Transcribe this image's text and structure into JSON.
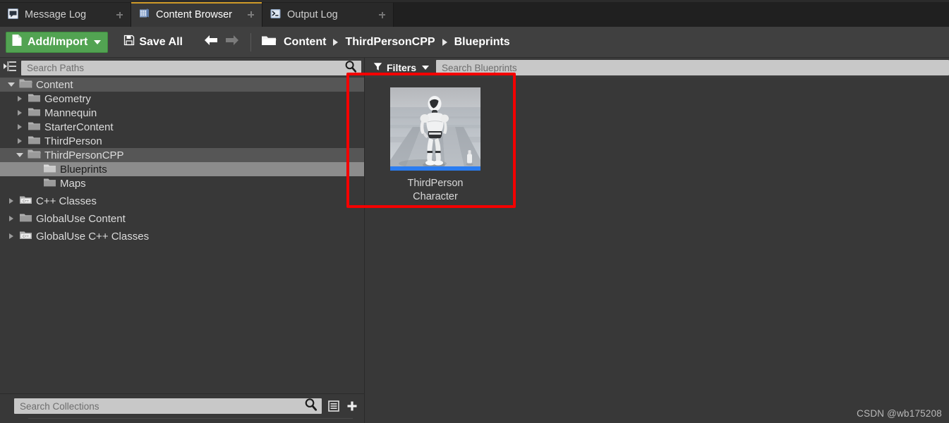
{
  "window": {
    "tabs": [
      {
        "label": "Message Log",
        "icon": "message-log-icon",
        "active": false,
        "closable": true
      },
      {
        "label": "Content Browser",
        "icon": "content-browser-icon",
        "active": true,
        "closable": true
      },
      {
        "label": "Output Log",
        "icon": "output-log-icon",
        "active": false,
        "closable": true
      }
    ]
  },
  "toolbar": {
    "add_import_label": "Add/Import",
    "add_import_icon": "new-document-icon",
    "save_all_label": "Save All",
    "save_all_icon": "floppy-disk-icon",
    "back_icon": "arrow-left-icon",
    "forward_icon": "arrow-right-icon",
    "folder_icon": "folder-open-icon",
    "breadcrumb": [
      "Content",
      "ThirdPersonCPP",
      "Blueprints"
    ]
  },
  "sources_panel": {
    "toggle_icon": "collapse-sources-icon",
    "search": {
      "placeholder": "Search Paths",
      "value": "",
      "icon": "search-icon"
    },
    "tree": [
      {
        "label": "Content",
        "depth": 0,
        "state": "expanded",
        "icon": "folder-open-icon",
        "row": "highlighted"
      },
      {
        "label": "Geometry",
        "depth": 1,
        "state": "collapsed",
        "icon": "folder-icon",
        "row": "normal"
      },
      {
        "label": "Mannequin",
        "depth": 1,
        "state": "collapsed",
        "icon": "folder-icon",
        "row": "normal"
      },
      {
        "label": "StarterContent",
        "depth": 1,
        "state": "collapsed",
        "icon": "folder-icon",
        "row": "normal"
      },
      {
        "label": "ThirdPerson",
        "depth": 1,
        "state": "collapsed",
        "icon": "folder-icon",
        "row": "normal"
      },
      {
        "label": "ThirdPersonCPP",
        "depth": 1,
        "state": "expanded",
        "icon": "folder-open-icon",
        "row": "highlighted"
      },
      {
        "label": "Blueprints",
        "depth": 2,
        "state": "leaf",
        "icon": "folder-icon",
        "row": "selected"
      },
      {
        "label": "Maps",
        "depth": 2,
        "state": "leaf",
        "icon": "folder-icon",
        "row": "normal"
      },
      {
        "label": "C++ Classes",
        "depth": 0,
        "state": "collapsed",
        "icon": "cpp-folder-icon",
        "row": "normal"
      },
      {
        "label": "GlobalUse Content",
        "depth": 0,
        "state": "collapsed",
        "icon": "folder-icon",
        "row": "normal"
      },
      {
        "label": "GlobalUse C++ Classes",
        "depth": 0,
        "state": "collapsed",
        "icon": "cpp-folder-icon",
        "row": "normal"
      }
    ],
    "collections": {
      "search": {
        "placeholder": "Search Collections",
        "value": "",
        "icon": "search-icon"
      },
      "options_icon": "list-options-icon",
      "add_icon": "plus-icon"
    }
  },
  "asset_panel": {
    "filters_label": "Filters",
    "filters_icon": "funnel-icon",
    "search": {
      "placeholder": "Search Blueprints",
      "value": "",
      "icon": "search-icon"
    },
    "assets": [
      {
        "name_line1": "ThirdPerson",
        "name_line2": "Character",
        "type_color": "#2a7cf0",
        "thumbnail": "mannequin-character-thumbnail"
      }
    ]
  },
  "annotation": {
    "color": "#f40000",
    "shape": "rectangle"
  },
  "watermark": "CSDN @wb175208"
}
